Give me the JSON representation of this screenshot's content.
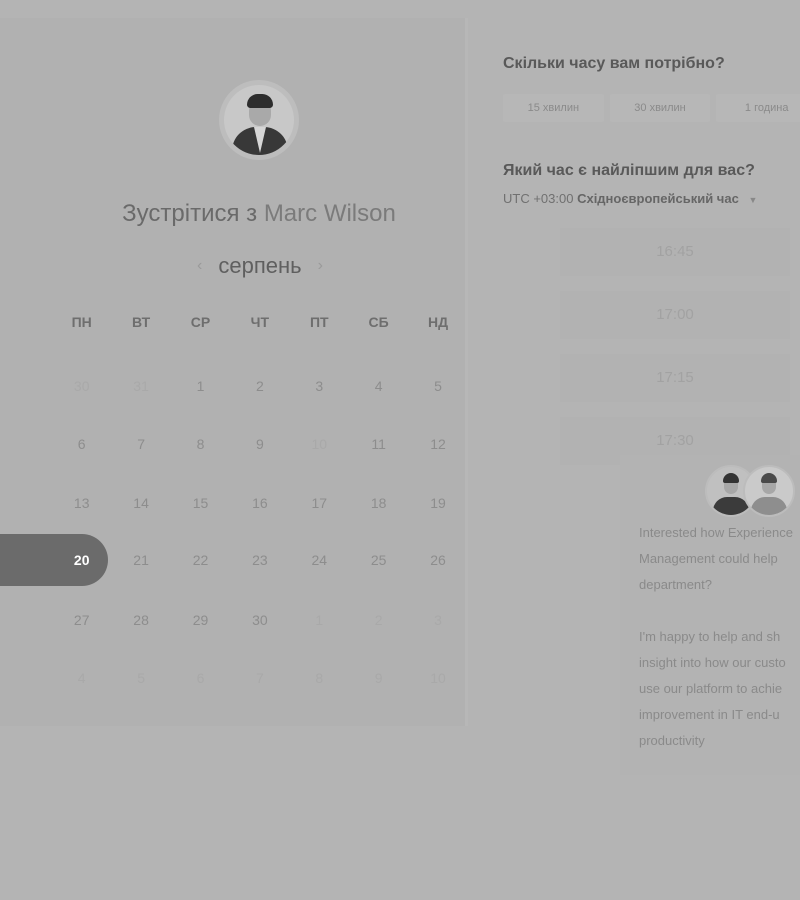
{
  "calendar": {
    "title_prefix": "Зустрітися з",
    "host_name": "Marc Wilson",
    "month": "серпень",
    "weekdays": [
      "ПН",
      "ВТ",
      "СР",
      "ЧТ",
      "ПТ",
      "СБ",
      "НД"
    ],
    "weeks": [
      [
        "30",
        "31",
        "1",
        "2",
        "3",
        "4",
        "5"
      ],
      [
        "6",
        "7",
        "8",
        "9",
        "10",
        "11",
        "12"
      ],
      [
        "13",
        "14",
        "15",
        "16",
        "17",
        "18",
        "19"
      ],
      [
        "20",
        "21",
        "22",
        "23",
        "24",
        "25",
        "26"
      ],
      [
        "27",
        "28",
        "29",
        "30",
        "1",
        "2",
        "3"
      ],
      [
        "4",
        "5",
        "6",
        "7",
        "8",
        "9",
        "10"
      ]
    ],
    "selected_day": "20"
  },
  "booking": {
    "duration_question": "Скільки часу вам потрібно?",
    "durations": [
      "15 хвилин",
      "30 хвилин",
      "1 година"
    ],
    "time_question": "Який час є найліпшим для вас?",
    "timezone_offset": "UTC +03:00",
    "timezone_name": "Східноєвропейський час",
    "slots": [
      "16:45",
      "17:00",
      "17:15",
      "17:30"
    ]
  },
  "info": {
    "paragraph1": [
      "Interested how Experience",
      "Management could help",
      "department?"
    ],
    "paragraph2": [
      "I'm happy to help and sh",
      "insight into how our custo",
      "use our platform to achie",
      "improvement in IT end-u",
      "productivity"
    ]
  },
  "icons": {
    "prev_month": "chevron-left-icon",
    "next_month": "chevron-right-icon",
    "timezone_dropdown": "caret-down-icon"
  }
}
